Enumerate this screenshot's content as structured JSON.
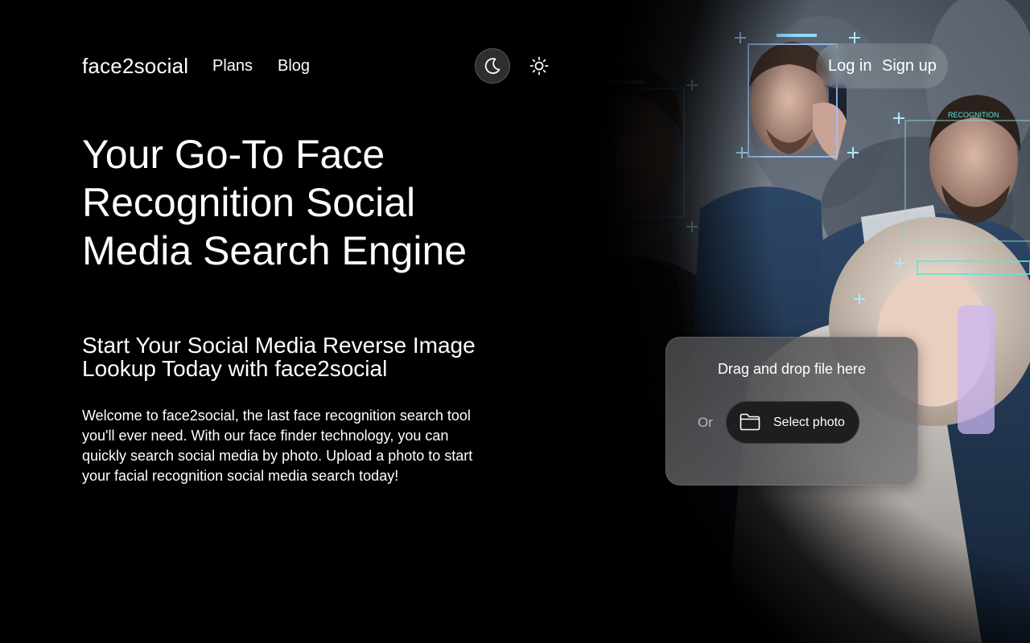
{
  "header": {
    "logo": "face2social",
    "nav": {
      "plans": "Plans",
      "blog": "Blog"
    },
    "auth": {
      "login": "Log in",
      "signup": "Sign up"
    },
    "theme_toggle": {
      "dark_icon": "moon-icon",
      "light_icon": "sun-icon",
      "selected": "dark"
    }
  },
  "hero": {
    "title": "Your Go-To Face Recognition Social Media Search Engine",
    "subtitle": "Start Your Social Media Reverse Image Lookup Today with face2social",
    "body": "Welcome to face2social, the last face recognition search tool you'll ever need. With our face finder technology, you can quickly search social media by photo. Upload a photo to start your facial recognition social media search today!",
    "background_overlay_label": "RECOGNITION"
  },
  "upload": {
    "drop_text": "Drag and drop file here",
    "or_text": "Or",
    "button_label": "Select photo",
    "button_icon": "folder-icon"
  },
  "colors": {
    "background": "#000000",
    "text": "#ffffff",
    "card": "#5a5a5c",
    "button": "#1e1e20",
    "scan_accent": "#5fe6d6"
  }
}
